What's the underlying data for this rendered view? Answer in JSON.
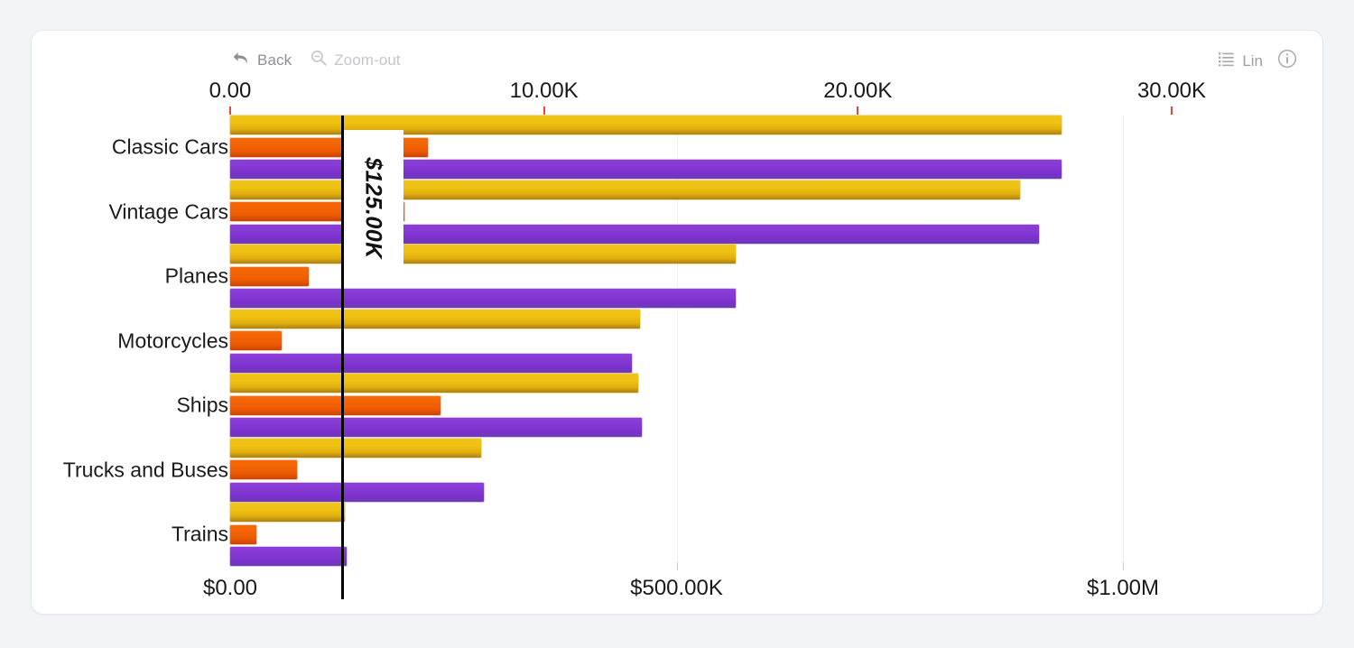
{
  "toolbar": {
    "back_label": "Back",
    "back_icon": "back-arrow-icon",
    "zoomout_label": "Zoom-out",
    "zoomout_icon": "magnifier-minus-icon",
    "scale_label": "Lin",
    "scale_icon": "list-lines-icon",
    "info_icon": "info-circle-icon"
  },
  "chart_data": {
    "type": "bar",
    "orientation": "horizontal",
    "title": "",
    "categories": [
      "Classic Cars",
      "Vintage Cars",
      "Planes",
      "Motorcycles",
      "Ships",
      "Trucks and Buses",
      "Trains"
    ],
    "series": [
      {
        "name": "gold",
        "color": "#e8bb10",
        "axis": "bottom",
        "values": [
          931000,
          885000,
          566000,
          459000,
          457000,
          281000,
          128000
        ]
      },
      {
        "name": "orange",
        "color": "#f06000",
        "axis": "top",
        "values": [
          6300,
          5550,
          2500,
          1650,
          6700,
          2130,
          830
        ]
      },
      {
        "name": "purple",
        "color": "#7f33d0",
        "axis": "bottom",
        "values": [
          931000,
          906000,
          566000,
          450000,
          461000,
          284000,
          130000
        ]
      }
    ],
    "top_axis": {
      "label": "",
      "tick_labels": [
        "0.00",
        "10.00K",
        "20.00K",
        "30.00K"
      ],
      "tick_values": [
        0,
        10000,
        20000,
        30000
      ],
      "range": [
        0,
        36000
      ],
      "tick_color": "#e8453c"
    },
    "bottom_axis": {
      "label": "",
      "tick_labels": [
        "$0.00",
        "$500.00K",
        "$1.00M"
      ],
      "tick_values": [
        0,
        500000,
        1000000
      ],
      "range": [
        0,
        1200000
      ]
    },
    "reference_line": {
      "label": "$125.00K",
      "value": 125000,
      "axis": "bottom",
      "color": "#000000"
    },
    "grid": true,
    "legend": "none"
  }
}
